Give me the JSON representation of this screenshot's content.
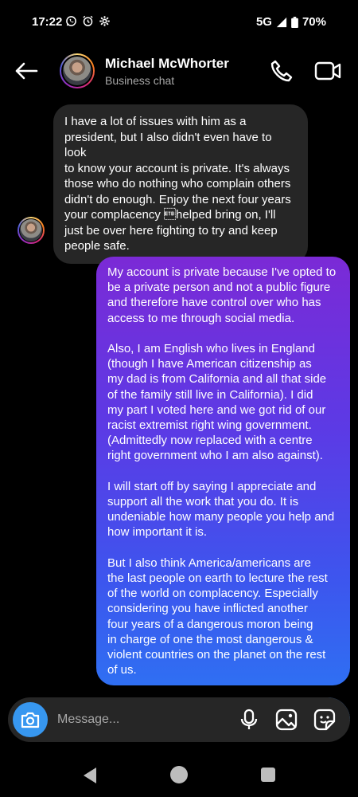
{
  "status_bar": {
    "time": "17:22",
    "network": "5G",
    "battery": "70%",
    "icons": [
      "whatsapp-icon",
      "alarm-icon",
      "settings-icon",
      "signal-icon",
      "battery-icon"
    ]
  },
  "header": {
    "contact_name": "Michael McWhorter",
    "subtitle": "Business chat",
    "icons": [
      "back-arrow-icon",
      "phone-icon",
      "video-camera-icon"
    ]
  },
  "messages": [
    {
      "direction": "received",
      "text": "I have a lot of issues with him as a\npresident, but I also didn't even have to look\nto know your account is private. It's always\nthose who do nothing who complain others\ndidn't do enough. Enjoy the next four years\nyour complacency \u0017helped bring on, I'll\njust be over here fighting to try and keep\npeople safe."
    },
    {
      "direction": "sent",
      "text": "My account is private because I've opted to\nbe a private person and not a public figure\nand therefore have control over who has\naccess to me through social media.\n\nAlso, I am English who lives in England\n(though I have American citizenship as\nmy dad is from California and all that side\nof the family still live in California). I did\nmy part I voted here and we got rid of our\nracist extremist right wing government.\n(Admittedly now replaced with a centre\nright government who I am also against).\n\nI will start off by saying I appreciate and\nsupport all the work that you do. It is\nundeniable how many people you help and\nhow important it is.\n\nBut I also think America/americans are\nthe last people on earth to lecture the rest\nof the world on complacency. Especially\nconsidering you have inflicted another\nfour years of a dangerous moron being\nin charge of one the most dangerous &\nviolent countries on the planet on the rest\nof us."
    }
  ],
  "composer": {
    "placeholder": "Message...",
    "icons": [
      "camera-icon",
      "microphone-icon",
      "gallery-icon",
      "sticker-icon"
    ]
  },
  "colors": {
    "background": "#000000",
    "received_bubble": "#262626",
    "sent_gradient_top": "#7b2ad6",
    "sent_gradient_bottom": "#2f6ff2",
    "camera_button": "#3797f0",
    "secondary_text": "#a8a8a8"
  }
}
